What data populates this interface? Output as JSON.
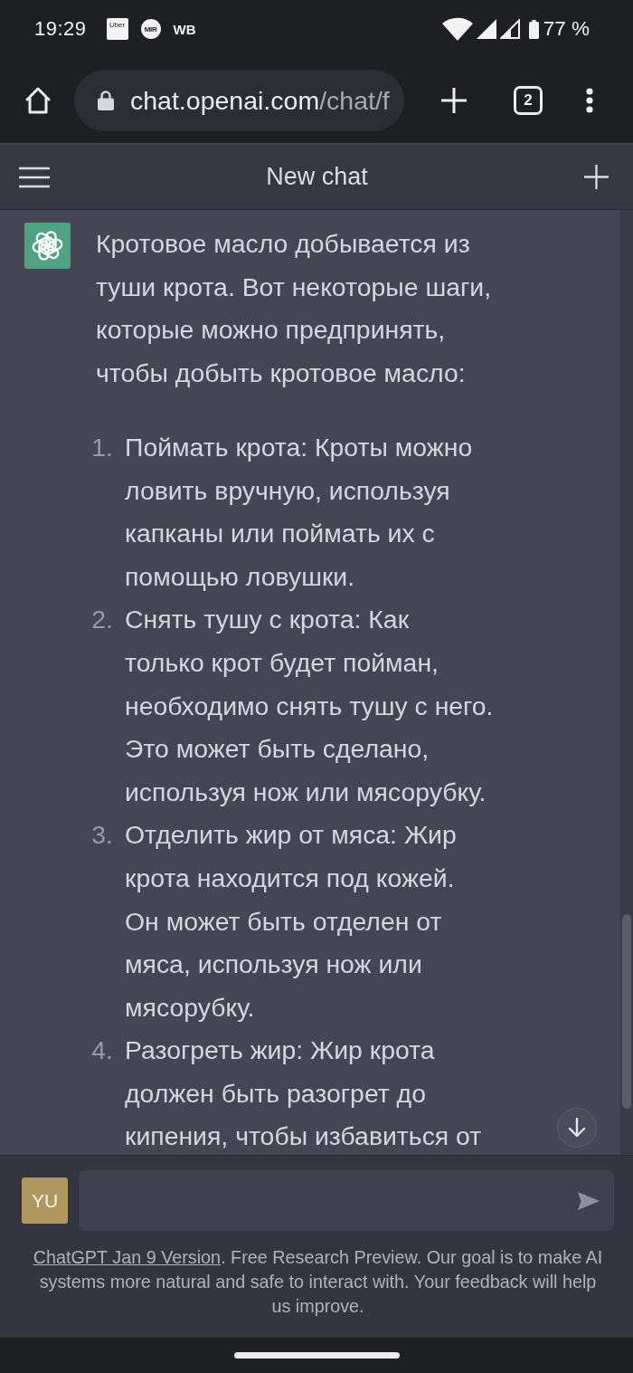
{
  "status_bar": {
    "time": "19:29",
    "notifications": [
      {
        "kind": "tile",
        "label": "Uber"
      },
      {
        "kind": "disc",
        "label": "MIR"
      },
      {
        "kind": "text",
        "label": "WB"
      }
    ],
    "battery": "77 %"
  },
  "browser_bar": {
    "url_domain": "chat.openai.com",
    "url_path": "/chat/f",
    "tab_count": "2"
  },
  "header": {
    "title": "New chat"
  },
  "message": {
    "paragraph": "Кротовое масло добывается из туши крота. Вот некоторые шаги, которые можно предпринять, чтобы добыть кротовое масло:",
    "steps": [
      {
        "number": "1.",
        "text": "Поймать крота: Кроты можно ловить вручную, используя капканы или поймать их с помощью ловушки."
      },
      {
        "number": "2.",
        "text": "Снять тушу с крота: Как только крот будет пойман, необходимо снять тушу с него. Это может быть сделано, используя нож или мясорубку."
      },
      {
        "number": "3.",
        "text": "Отделить жир от мяса: Жир крота находится под кожей. Он может быть отделен от мяса, используя нож или мясорубку."
      },
      {
        "number": "4.",
        "text": "Разогреть жир: Жир крота должен быть разогрет до кипения, чтобы избавиться от"
      }
    ]
  },
  "composer": {
    "avatar": "YU"
  },
  "disclaimer": {
    "link": "ChatGPT Jan 9 Version",
    "text": ". Free Research Preview. Our goal is to make AI systems more natural and safe to interact with. Your feedback will help us improve."
  }
}
